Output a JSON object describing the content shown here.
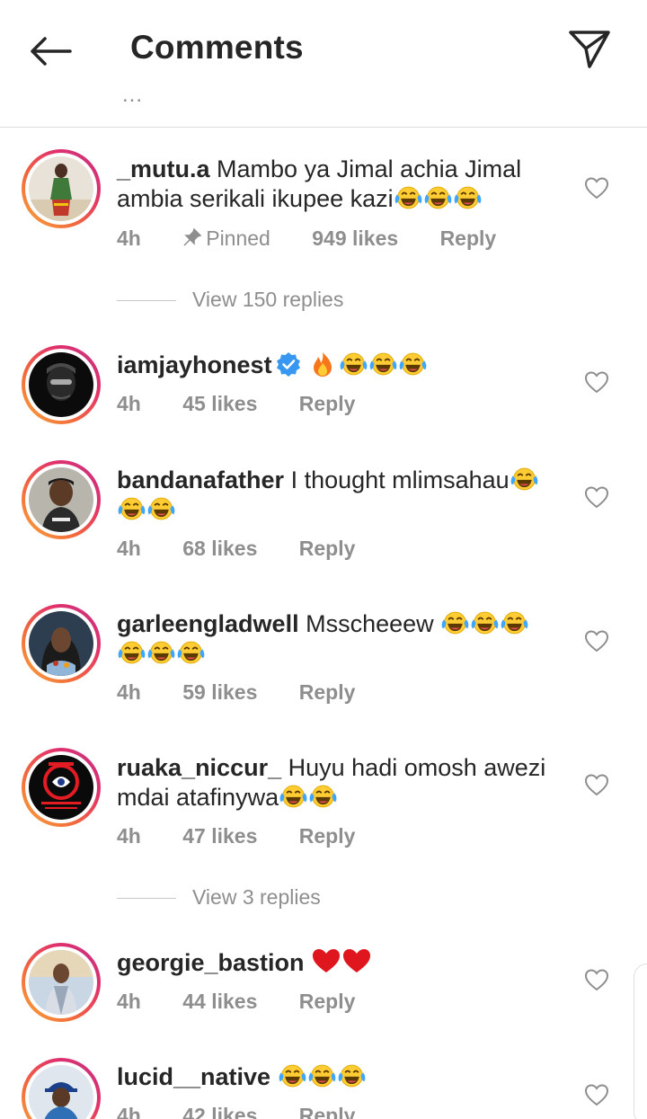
{
  "header": {
    "title": "Comments",
    "back_icon": "arrow-left-icon",
    "send_icon": "paper-plane-icon",
    "more": "..."
  },
  "comments": [
    {
      "username": "_mutu.a",
      "text": "Mambo ya Jimal achia Jimal ambia serikali ikupee kazi",
      "emoji_count": 3,
      "time": "4h",
      "pinned": "Pinned",
      "likes": "949 likes",
      "reply": "Reply",
      "view_replies": "View 150 replies"
    },
    {
      "username": "iamjayhonest",
      "verified": true,
      "text": "",
      "time": "4h",
      "likes": "45 likes",
      "reply": "Reply"
    },
    {
      "username": "bandanafather",
      "text": "I thought mlimsahau",
      "time": "4h",
      "likes": "68 likes",
      "reply": "Reply"
    },
    {
      "username": "garleengladwell",
      "text": "Msscheeew",
      "time": "4h",
      "likes": "59 likes",
      "reply": "Reply"
    },
    {
      "username": "ruaka_niccur_",
      "text": "Huyu hadi omosh awezi mdai atafinywa",
      "time": "4h",
      "likes": "47 likes",
      "reply": "Reply",
      "view_replies": "View 3 replies"
    },
    {
      "username": "georgie_bastion",
      "text": "",
      "time": "4h",
      "likes": "44 likes",
      "reply": "Reply"
    },
    {
      "username": "lucid__native",
      "text": "",
      "time": "4h",
      "likes": "42 likes",
      "reply": "Reply"
    }
  ],
  "colors": {
    "text": "#262626",
    "secondary": "#8e8e8e",
    "verified": "#3897f0",
    "heart_red": "#ed4956"
  }
}
